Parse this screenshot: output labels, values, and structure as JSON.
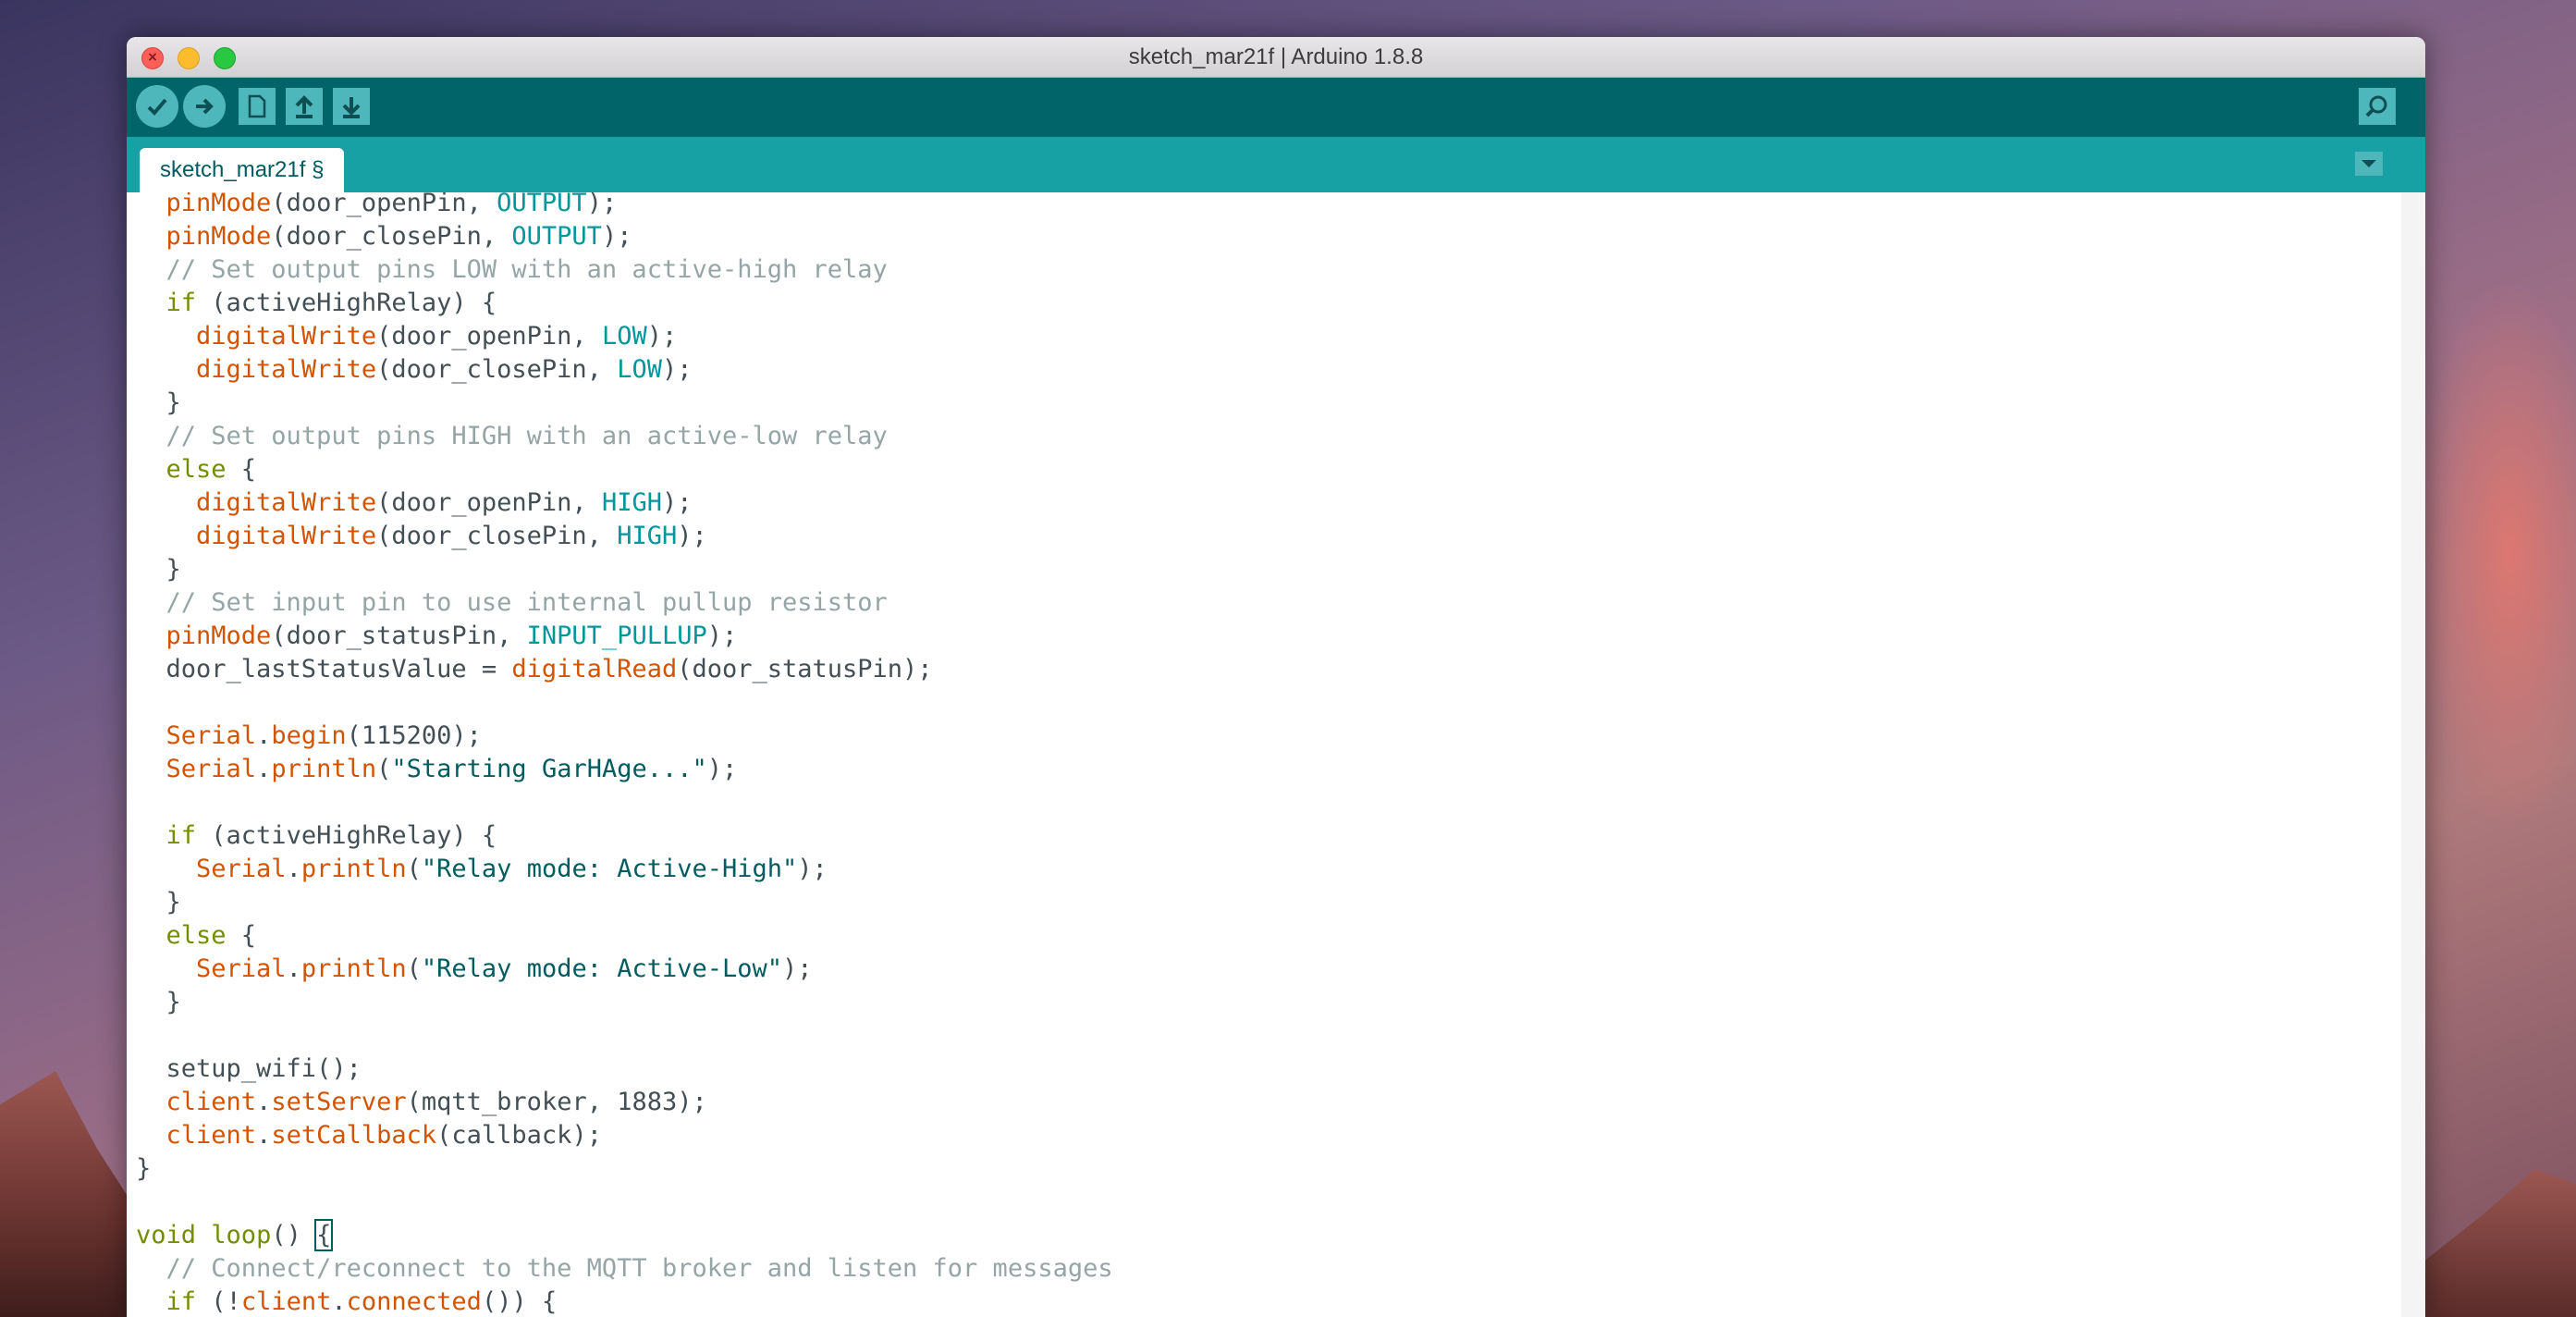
{
  "window": {
    "title": "sketch_mar21f | Arduino 1.8.8"
  },
  "titlebar": {
    "close_glyph": "×",
    "minimize_glyph": "−",
    "maximize_glyph": "+"
  },
  "toolbar": {
    "verify_icon": "checkmark-icon",
    "upload_icon": "arrow-right-icon",
    "new_icon": "document-icon",
    "open_icon": "arrow-up-icon",
    "save_icon": "arrow-down-icon",
    "serial_monitor_icon": "magnifier-icon",
    "accent_color": "#006468",
    "button_color": "#4db7bb"
  },
  "tabs": [
    {
      "label": "sketch_mar21f §"
    }
  ],
  "code_lines": [
    [
      {
        "t": "  "
      },
      {
        "t": "pinMode",
        "c": "kw"
      },
      {
        "t": "(door_openPin, "
      },
      {
        "t": "OUTPUT",
        "c": "cn"
      },
      {
        "t": ");"
      }
    ],
    [
      {
        "t": "  "
      },
      {
        "t": "pinMode",
        "c": "kw"
      },
      {
        "t": "(door_closePin, "
      },
      {
        "t": "OUTPUT",
        "c": "cn"
      },
      {
        "t": ");"
      }
    ],
    [
      {
        "t": "  "
      },
      {
        "t": "// Set output pins LOW with an active-high relay",
        "c": "cm"
      }
    ],
    [
      {
        "t": "  "
      },
      {
        "t": "if",
        "c": "ctl"
      },
      {
        "t": " (activeHighRelay) {"
      }
    ],
    [
      {
        "t": "    "
      },
      {
        "t": "digitalWrite",
        "c": "kw"
      },
      {
        "t": "(door_openPin, "
      },
      {
        "t": "LOW",
        "c": "cn"
      },
      {
        "t": ");"
      }
    ],
    [
      {
        "t": "    "
      },
      {
        "t": "digitalWrite",
        "c": "kw"
      },
      {
        "t": "(door_closePin, "
      },
      {
        "t": "LOW",
        "c": "cn"
      },
      {
        "t": ");"
      }
    ],
    [
      {
        "t": "  }"
      }
    ],
    [
      {
        "t": "  "
      },
      {
        "t": "// Set output pins HIGH with an active-low relay",
        "c": "cm"
      }
    ],
    [
      {
        "t": "  "
      },
      {
        "t": "else",
        "c": "ctl"
      },
      {
        "t": " {"
      }
    ],
    [
      {
        "t": "    "
      },
      {
        "t": "digitalWrite",
        "c": "kw"
      },
      {
        "t": "(door_openPin, "
      },
      {
        "t": "HIGH",
        "c": "cn"
      },
      {
        "t": ");"
      }
    ],
    [
      {
        "t": "    "
      },
      {
        "t": "digitalWrite",
        "c": "kw"
      },
      {
        "t": "(door_closePin, "
      },
      {
        "t": "HIGH",
        "c": "cn"
      },
      {
        "t": ");"
      }
    ],
    [
      {
        "t": "  }"
      }
    ],
    [
      {
        "t": "  "
      },
      {
        "t": "// Set input pin to use internal pullup resistor",
        "c": "cm"
      }
    ],
    [
      {
        "t": "  "
      },
      {
        "t": "pinMode",
        "c": "kw"
      },
      {
        "t": "(door_statusPin, "
      },
      {
        "t": "INPUT_PULLUP",
        "c": "cn"
      },
      {
        "t": ");"
      }
    ],
    [
      {
        "t": "  door_lastStatusValue = "
      },
      {
        "t": "digitalRead",
        "c": "kw"
      },
      {
        "t": "(door_statusPin);"
      }
    ],
    [
      {
        "t": ""
      }
    ],
    [
      {
        "t": "  "
      },
      {
        "t": "Serial",
        "c": "kw"
      },
      {
        "t": "."
      },
      {
        "t": "begin",
        "c": "kw"
      },
      {
        "t": "(115200);"
      }
    ],
    [
      {
        "t": "  "
      },
      {
        "t": "Serial",
        "c": "kw"
      },
      {
        "t": "."
      },
      {
        "t": "println",
        "c": "kw"
      },
      {
        "t": "("
      },
      {
        "t": "\"Starting GarHAge...\"",
        "c": "str"
      },
      {
        "t": ");"
      }
    ],
    [
      {
        "t": ""
      }
    ],
    [
      {
        "t": "  "
      },
      {
        "t": "if",
        "c": "ctl"
      },
      {
        "t": " (activeHighRelay) {"
      }
    ],
    [
      {
        "t": "    "
      },
      {
        "t": "Serial",
        "c": "kw"
      },
      {
        "t": "."
      },
      {
        "t": "println",
        "c": "kw"
      },
      {
        "t": "("
      },
      {
        "t": "\"Relay mode: Active-High\"",
        "c": "str"
      },
      {
        "t": ");"
      }
    ],
    [
      {
        "t": "  }"
      }
    ],
    [
      {
        "t": "  "
      },
      {
        "t": "else",
        "c": "ctl"
      },
      {
        "t": " {"
      }
    ],
    [
      {
        "t": "    "
      },
      {
        "t": "Serial",
        "c": "kw"
      },
      {
        "t": "."
      },
      {
        "t": "println",
        "c": "kw"
      },
      {
        "t": "("
      },
      {
        "t": "\"Relay mode: Active-Low\"",
        "c": "str"
      },
      {
        "t": ");"
      }
    ],
    [
      {
        "t": "  }"
      }
    ],
    [
      {
        "t": ""
      }
    ],
    [
      {
        "t": "  setup_wifi();"
      }
    ],
    [
      {
        "t": "  "
      },
      {
        "t": "client",
        "c": "kw"
      },
      {
        "t": "."
      },
      {
        "t": "setServer",
        "c": "kw"
      },
      {
        "t": "(mqtt_broker, 1883);"
      }
    ],
    [
      {
        "t": "  "
      },
      {
        "t": "client",
        "c": "kw"
      },
      {
        "t": "."
      },
      {
        "t": "setCallback",
        "c": "kw"
      },
      {
        "t": "(callback);"
      }
    ],
    [
      {
        "t": "}"
      }
    ],
    [
      {
        "t": ""
      }
    ],
    [
      {
        "t": "void",
        "c": "ctl"
      },
      {
        "t": " "
      },
      {
        "t": "loop",
        "c": "ctl"
      },
      {
        "t": "() "
      },
      {
        "t": "{",
        "c": "hl"
      }
    ],
    [
      {
        "t": "  "
      },
      {
        "t": "// Connect/reconnect to the MQTT broker and listen for messages",
        "c": "cm"
      }
    ],
    [
      {
        "t": "  "
      },
      {
        "t": "if",
        "c": "ctl"
      },
      {
        "t": " (!"
      },
      {
        "t": "client",
        "c": "kw"
      },
      {
        "t": "."
      },
      {
        "t": "connected",
        "c": "kw"
      },
      {
        "t": "()) {"
      }
    ]
  ]
}
